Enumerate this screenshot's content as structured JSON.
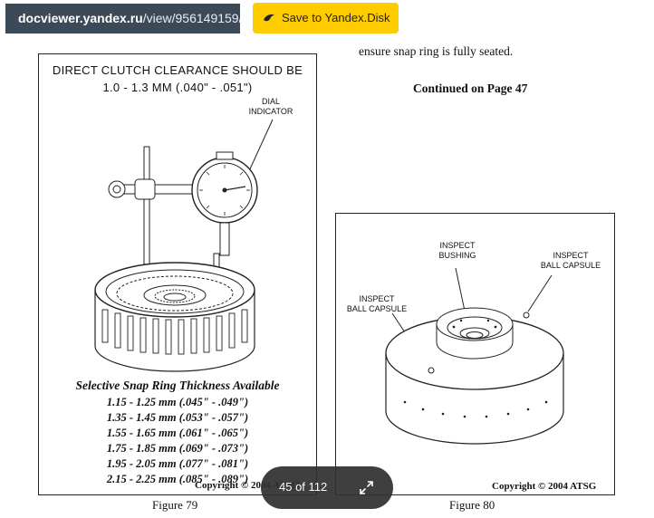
{
  "toolbar": {
    "url_host": "docviewer.yandex.ru",
    "url_path": "/view/956149159/",
    "save_label": "Save to Yandex.Disk",
    "save_color": "#ffcc00"
  },
  "document": {
    "intro_text": "ensure snap ring is fully seated.",
    "continued": "Continued on Page 47",
    "figure79": {
      "title_line1": "DIRECT CLUTCH CLEARANCE SHOULD BE",
      "title_line2": "1.0 - 1.3 MM  (.040\" - .051\")",
      "dial_label_line1": "DIAL",
      "dial_label_line2": "INDICATOR",
      "snap_heading": "Selective Snap Ring Thickness Available",
      "snap_rows": [
        "1.15 - 1.25 mm  (.045\" - .049\")",
        "1.35 - 1.45 mm  (.053\" - .057\")",
        "1.55 - 1.65 mm  (.061\" - .065\")",
        "1.75 - 1.85 mm  (.069\" - .073\")",
        "1.95 - 2.05 mm  (.077\" - .081\")",
        "2.15 - 2.25 mm  (.085\" - .089\")"
      ],
      "copyright": "Copyright © 2004 ATSG",
      "caption": "Figure 79"
    },
    "figure80": {
      "inspect_bushing_line1": "INSPECT",
      "inspect_bushing_line2": "BUSHING",
      "inspect_ball_right_line1": "INSPECT",
      "inspect_ball_right_line2": "BALL CAPSULE",
      "inspect_ball_left_line1": "INSPECT",
      "inspect_ball_left_line2": "BALL CAPSULE",
      "copyright": "Copyright © 2004 ATSG",
      "caption": "Figure 80"
    }
  },
  "pager": {
    "page_text": "45 of 112",
    "expand_icon": "expand-icon"
  }
}
